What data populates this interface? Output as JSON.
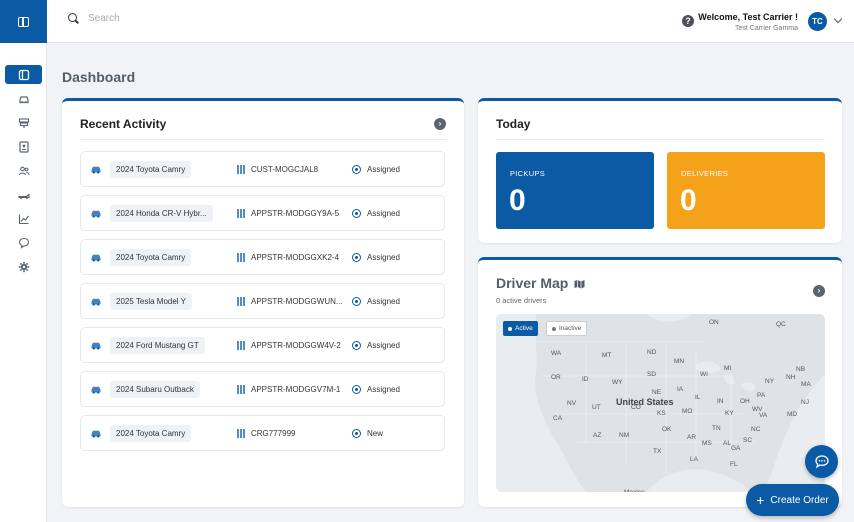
{
  "header": {
    "search_placeholder": "Search",
    "help_icon": "?",
    "welcome": "Welcome, Test Carrier !",
    "company": "Test Carrier Gamma",
    "avatar_initials": "TC"
  },
  "sidebar": {
    "items": [
      {
        "icon": "dashboard-icon",
        "active": true
      },
      {
        "icon": "car-icon"
      },
      {
        "icon": "signpost-icon"
      },
      {
        "icon": "id-card-icon"
      },
      {
        "icon": "users-icon"
      },
      {
        "icon": "truck-icon"
      },
      {
        "icon": "chart-icon"
      },
      {
        "icon": "chat-icon"
      },
      {
        "icon": "gear-icon"
      }
    ]
  },
  "page": {
    "title": "Dashboard"
  },
  "recent": {
    "title": "Recent Activity",
    "rows": [
      {
        "vehicle": "2024 Toyota Camry",
        "order": "CUST-MOGCJAL8",
        "status": "Assigned"
      },
      {
        "vehicle": "2024 Honda CR-V Hybr...",
        "order": "APPSTR-MODGGY9A-5",
        "status": "Assigned"
      },
      {
        "vehicle": "2024 Toyota Camry",
        "order": "APPSTR-MODGGXK2-4",
        "status": "Assigned"
      },
      {
        "vehicle": "2025 Tesla Model Y",
        "order": "APPSTR-MODGGWUN...",
        "status": "Assigned"
      },
      {
        "vehicle": "2024 Ford Mustang GT",
        "order": "APPSTR-MODGGW4V-2",
        "status": "Assigned"
      },
      {
        "vehicle": "2024 Subaru Outback",
        "order": "APPSTR-MODGGV7M-1",
        "status": "Assigned"
      },
      {
        "vehicle": "2024 Toyota Camry",
        "order": "CRG777999",
        "status": "New"
      }
    ]
  },
  "today": {
    "title": "Today",
    "pickups_label": "PICKUPS",
    "pickups_value": "0",
    "deliveries_label": "DELIVERIES",
    "deliveries_value": "0",
    "pickups_color": "#0b5aa5",
    "deliveries_color": "#f5a21b"
  },
  "map": {
    "title": "Driver Map",
    "subtitle": "0 active drivers",
    "legend_active": "Active",
    "legend_inactive": "Inactive",
    "country": "United States",
    "states": [
      "ON",
      "QC",
      "WA",
      "MT",
      "ND",
      "MN",
      "NB",
      "OR",
      "ID",
      "WY",
      "SD",
      "WI",
      "MI",
      "NY",
      "NH",
      "MA",
      "NE",
      "IA",
      "PA",
      "NV",
      "UT",
      "CO",
      "IL",
      "IN",
      "OH",
      "NJ",
      "CA",
      "KS",
      "MO",
      "KY",
      "WV",
      "VA",
      "MD",
      "OK",
      "TN",
      "NC",
      "AZ",
      "NM",
      "AR",
      "SC",
      "MS",
      "AL",
      "GA",
      "TX",
      "LA",
      "FL",
      "Mexico"
    ]
  },
  "actions": {
    "create_order": "Create Order"
  }
}
